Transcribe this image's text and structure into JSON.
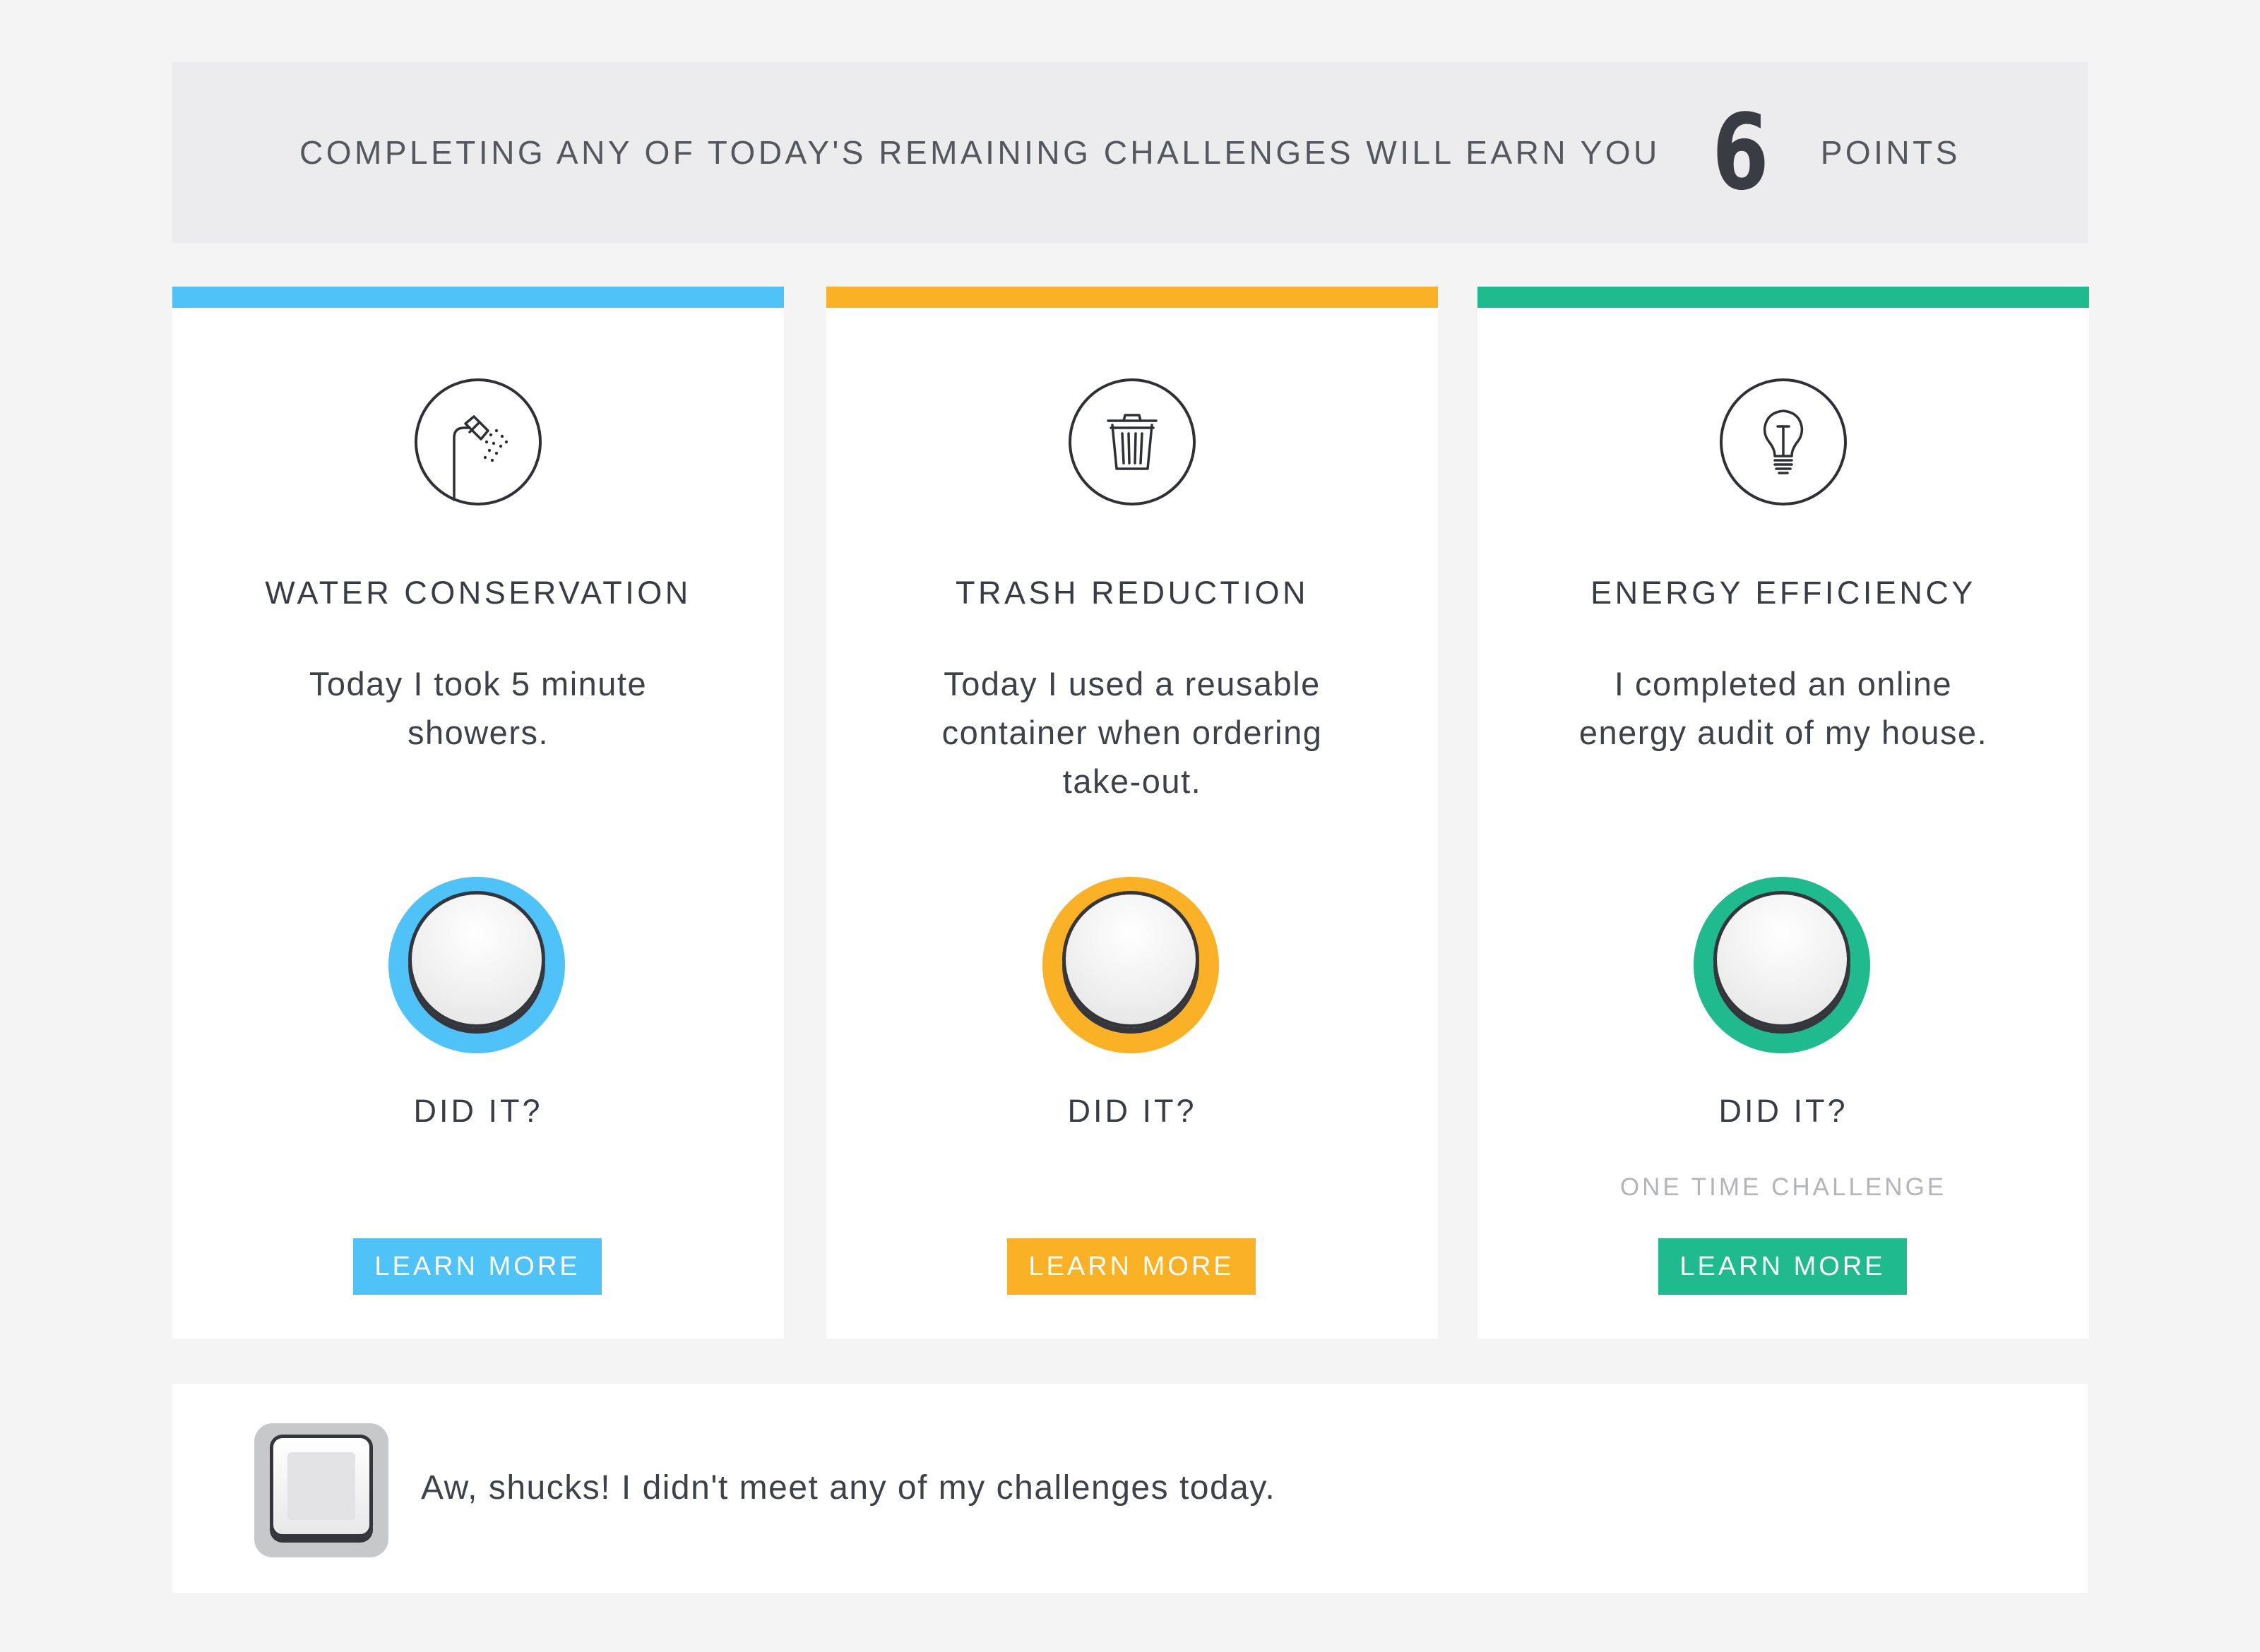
{
  "banner": {
    "prefix": "COMPLETING ANY OF TODAY'S REMAINING CHALLENGES WILL EARN YOU",
    "points": "6",
    "suffix": "POINTS"
  },
  "cards": [
    {
      "title": "WATER CONSERVATION",
      "description": "Today I took 5 minute showers.",
      "icon": "shower-icon",
      "did_it_label": "DID IT?",
      "note": "",
      "learn_more_label": "LEARN MORE",
      "accent_color": "#4fc3f7"
    },
    {
      "title": "TRASH REDUCTION",
      "description": "Today I used a reusable container when ordering take-out.",
      "icon": "trash-icon",
      "did_it_label": "DID IT?",
      "note": "",
      "learn_more_label": "LEARN MORE",
      "accent_color": "#fbb125"
    },
    {
      "title": "ENERGY EFFICIENCY",
      "description": "I completed an online energy audit of my house.",
      "icon": "lightbulb-icon",
      "did_it_label": "DID IT?",
      "note": "ONE TIME CHALLENGE",
      "learn_more_label": "LEARN MORE",
      "accent_color": "#1fbb8e"
    }
  ],
  "bottom": {
    "text": "Aw, shucks! I didn't meet any of my challenges today."
  }
}
